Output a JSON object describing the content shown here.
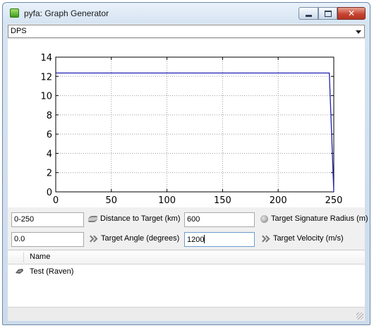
{
  "window": {
    "title": "pyfa: Graph Generator"
  },
  "graph_select": {
    "value": "DPS"
  },
  "chart_data": {
    "type": "line",
    "title": "",
    "xlabel": "",
    "ylabel": "",
    "xlim": [
      0,
      250
    ],
    "ylim": [
      0,
      14
    ],
    "x_ticks": [
      0,
      50,
      100,
      150,
      200,
      250
    ],
    "y_ticks": [
      0,
      2,
      4,
      6,
      8,
      10,
      12,
      14
    ],
    "grid": true,
    "line_color": "#1f1fb4",
    "series": [
      {
        "x": [
          0,
          246,
          250
        ],
        "y": [
          12.35,
          12.35,
          0
        ]
      }
    ]
  },
  "params": {
    "distance": {
      "value": "0-250",
      "label": "Distance to Target (km)"
    },
    "signature": {
      "value": "600",
      "label": "Target Signature Radius (m)"
    },
    "angle": {
      "value": "0.0",
      "label": "Target Angle (degrees)"
    },
    "velocity": {
      "value": "1200",
      "label": "Target Velocity (m/s)"
    }
  },
  "fit_list": {
    "column_name": "Name",
    "rows": [
      {
        "name": "Test (Raven)",
        "icon": "ship-icon"
      }
    ]
  }
}
